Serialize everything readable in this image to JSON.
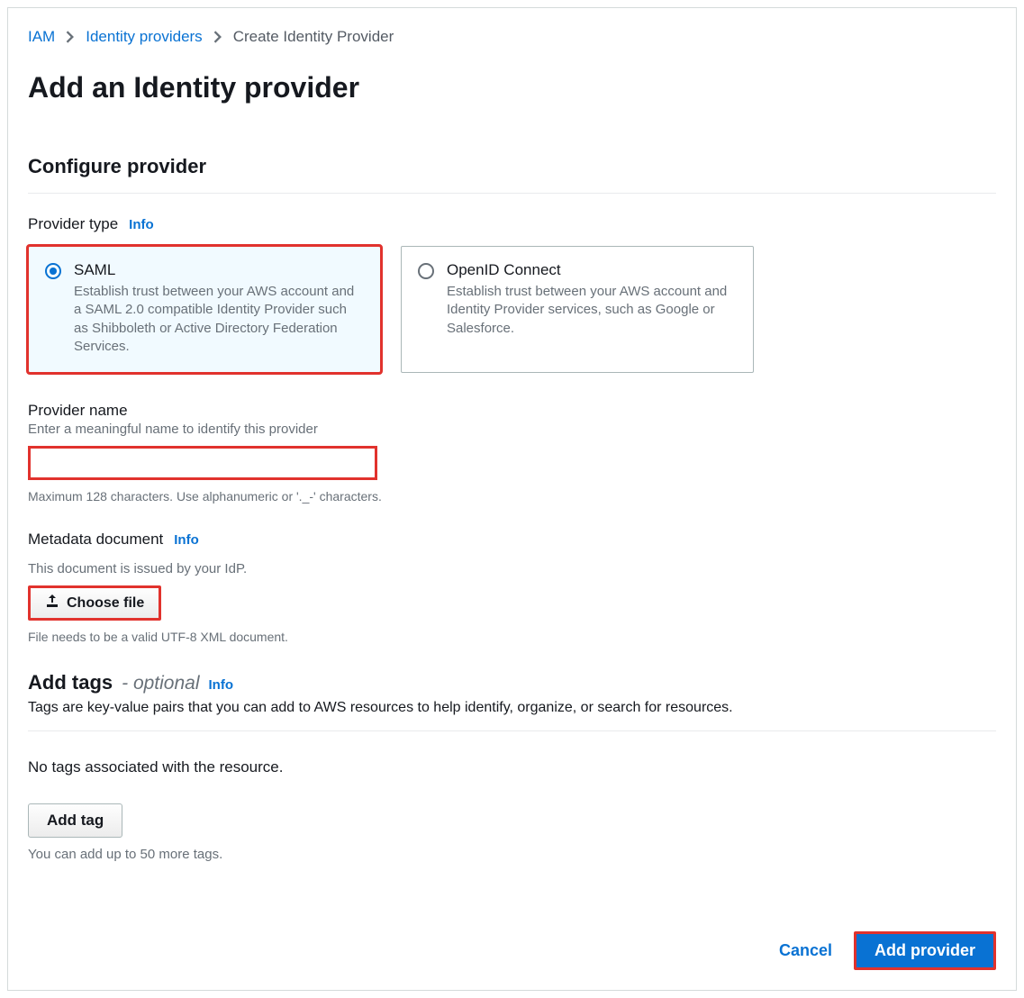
{
  "breadcrumb": {
    "items": [
      {
        "label": "IAM",
        "link": true
      },
      {
        "label": "Identity providers",
        "link": true
      },
      {
        "label": "Create Identity Provider",
        "link": false
      }
    ]
  },
  "page_title": "Add an Identity provider",
  "section": {
    "title": "Configure provider",
    "provider_type": {
      "label": "Provider type",
      "info": "Info",
      "options": [
        {
          "id": "saml",
          "title": "SAML",
          "desc": "Establish trust between your AWS account and a SAML 2.0 compatible Identity Provider such as Shibboleth or Active Directory Federation Services.",
          "selected": true
        },
        {
          "id": "oidc",
          "title": "OpenID Connect",
          "desc": "Establish trust between your AWS account and Identity Provider services, such as Google or Salesforce.",
          "selected": false
        }
      ]
    },
    "provider_name": {
      "label": "Provider name",
      "hint": "Enter a meaningful name to identify this provider",
      "value": "",
      "help": "Maximum 128 characters. Use alphanumeric or '._-' characters."
    },
    "metadata_document": {
      "label": "Metadata document",
      "info": "Info",
      "hint": "This document is issued by your IdP.",
      "button": "Choose file",
      "help": "File needs to be a valid UTF-8 XML document."
    }
  },
  "tags": {
    "heading": "Add tags",
    "optional": "- optional",
    "info": "Info",
    "desc": "Tags are key-value pairs that you can add to AWS resources to help identify, organize, or search for resources.",
    "no_tags": "No tags associated with the resource.",
    "add_button": "Add tag",
    "limit": "You can add up to 50 more tags."
  },
  "footer": {
    "cancel": "Cancel",
    "submit": "Add provider"
  }
}
